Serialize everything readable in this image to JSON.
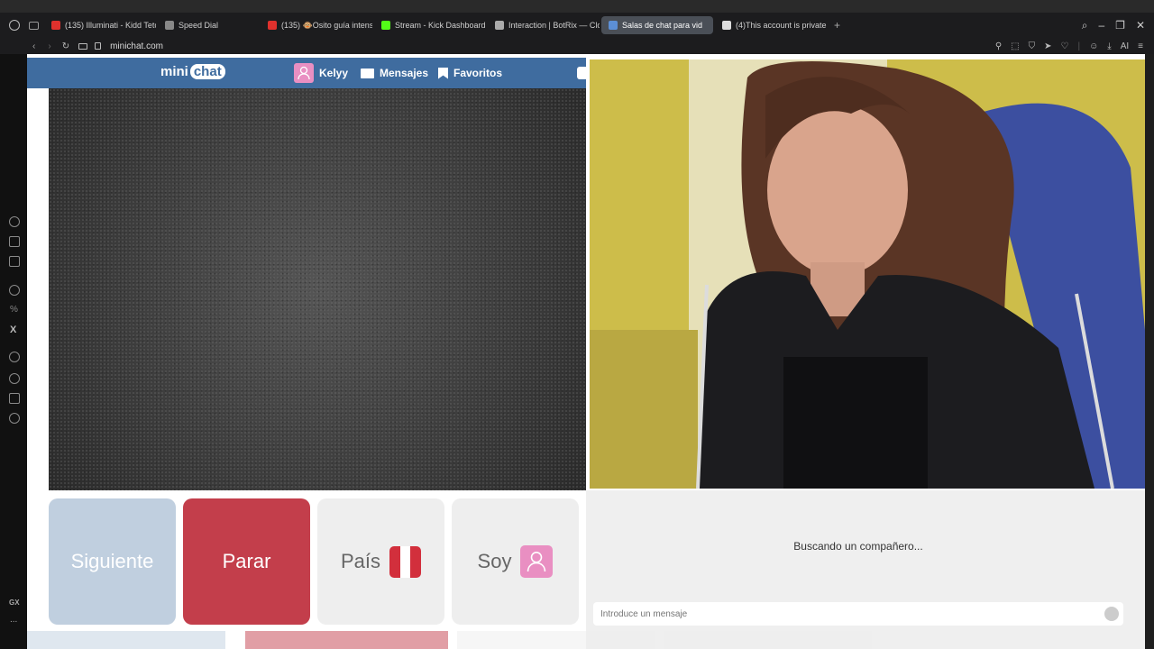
{
  "browser": {
    "tabs": [
      {
        "label": "(135) Illuminati - Kidd Teto",
        "color": "#e0312d"
      },
      {
        "label": "Speed Dial",
        "color": "#888888"
      },
      {
        "label": "(135) 🐵Osito guía intens",
        "color": "#e0312d"
      },
      {
        "label": "Stream - Kick Dashboard",
        "color": "#53fc18"
      },
      {
        "label": "Interaction | BotRix — Clo",
        "color": "#aaaaaa"
      },
      {
        "label": "Salas de chat para vid",
        "color": "#5c8fd6",
        "active": true
      },
      {
        "label": "(4)This account is private.",
        "color": "#dddddd"
      }
    ],
    "url": "minichat.com",
    "ai_label": "AI"
  },
  "sidebar": {
    "gx_label": "GX",
    "more_label": "..."
  },
  "header": {
    "logo_mini": "mini",
    "logo_chat": "chat",
    "user_name": "Kelyy",
    "messages_label": "Mensajes",
    "favorites_label": "Favoritos"
  },
  "controls": {
    "next_label": "Siguiente",
    "stop_label": "Parar",
    "country_label": "País",
    "gender_label": "Soy"
  },
  "chat": {
    "status": "Buscando un compañero...",
    "placeholder": "Introduce un mensaje"
  },
  "colors": {
    "header_bg": "#3f6c9f",
    "stop_button": "#c33e4b",
    "next_button": "#c0cfdf",
    "flag_red": "#d22f3c",
    "avatar_pink": "#e98fc2"
  }
}
